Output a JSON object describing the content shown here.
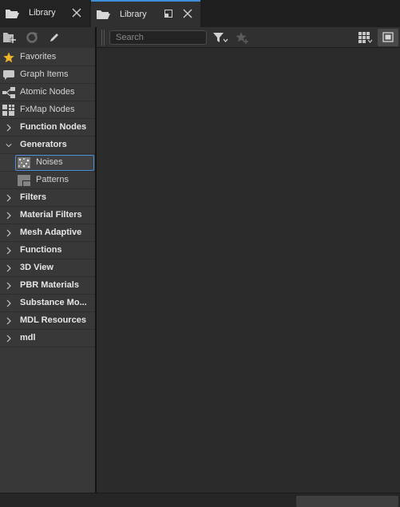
{
  "tabs": [
    {
      "label": "Library",
      "active": false
    },
    {
      "label": "Library",
      "active": true
    }
  ],
  "accent_color": "#3d8fd9",
  "sidebar": {
    "items": [
      {
        "label": "Favorites",
        "icon": "star-icon",
        "bold": false
      },
      {
        "label": "Graph Items",
        "icon": "comment-icon",
        "bold": false
      },
      {
        "label": "Atomic Nodes",
        "icon": "nodes-icon",
        "bold": false
      },
      {
        "label": "FxMap Nodes",
        "icon": "grid-icon",
        "bold": false
      },
      {
        "label": "Function Nodes",
        "icon": "chevron-right-icon",
        "bold": true
      },
      {
        "label": "Generators",
        "icon": "chevron-down-icon",
        "bold": true
      },
      {
        "label": "Noises",
        "icon": "noise-thumbnail-icon",
        "bold": false,
        "selected": true
      },
      {
        "label": "Patterns",
        "icon": "pattern-thumbnail-icon",
        "bold": false
      },
      {
        "label": "Filters",
        "icon": "chevron-right-icon",
        "bold": true
      },
      {
        "label": "Material Filters",
        "icon": "chevron-right-icon",
        "bold": true
      },
      {
        "label": "Mesh Adaptive",
        "icon": "chevron-right-icon",
        "bold": true
      },
      {
        "label": "Functions",
        "icon": "chevron-right-icon",
        "bold": true
      },
      {
        "label": "3D View",
        "icon": "chevron-right-icon",
        "bold": true
      },
      {
        "label": "PBR Materials",
        "icon": "chevron-right-icon",
        "bold": true
      },
      {
        "label": "Substance Mo...",
        "icon": "chevron-right-icon",
        "bold": true
      },
      {
        "label": "MDL Resources",
        "icon": "chevron-right-icon",
        "bold": true
      },
      {
        "label": "mdl",
        "icon": "chevron-right-icon",
        "bold": true
      }
    ]
  },
  "search": {
    "placeholder": "Search",
    "value": ""
  }
}
